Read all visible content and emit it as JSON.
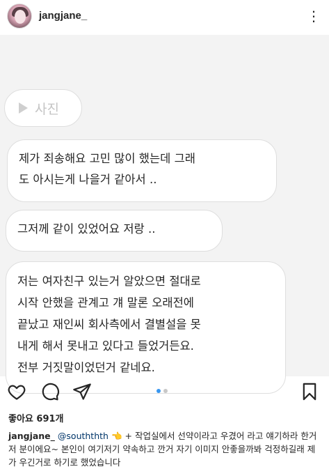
{
  "header": {
    "username": "jangjane_",
    "more_icon": "more-horizontal-icon"
  },
  "photo": {
    "chip_label": "사진",
    "messages": [
      "제가 죄송해요 고민 많이 했는데  그래\n도 아시는게 나을거 같아서 ..",
      "그저께 같이 있었어요 저랑  ..",
      "저는 여자친구 있는거 알았으면 절대로\n시작 안했을 관계고 걔 말론 오래전에\n끝났고 재인씨 회사측에서 결별설을 못\n내게 해서 못내고 있다고 들었거든요.\n전부 거짓말이었던거 같네요."
    ]
  },
  "actions": {
    "icons": [
      "heart-icon",
      "comment-icon",
      "share-icon",
      "bookmark-icon"
    ],
    "carousel": {
      "count": 2,
      "active": 0
    },
    "accent": "#3897f0"
  },
  "likes_text": "좋아요 691개",
  "caption": {
    "username": "jangjane_",
    "mention": "@souththth",
    "emoji": "👈",
    "text": " + 작업실에서 선약이라고 우겼어 라고 얘기하라 한거 저 분이에요~ 본인이 여기저기 약속하고 깐거 자기 이미지 안좋을까봐 걱정하길래 제가 우긴거로 하기로 했었습니다"
  }
}
